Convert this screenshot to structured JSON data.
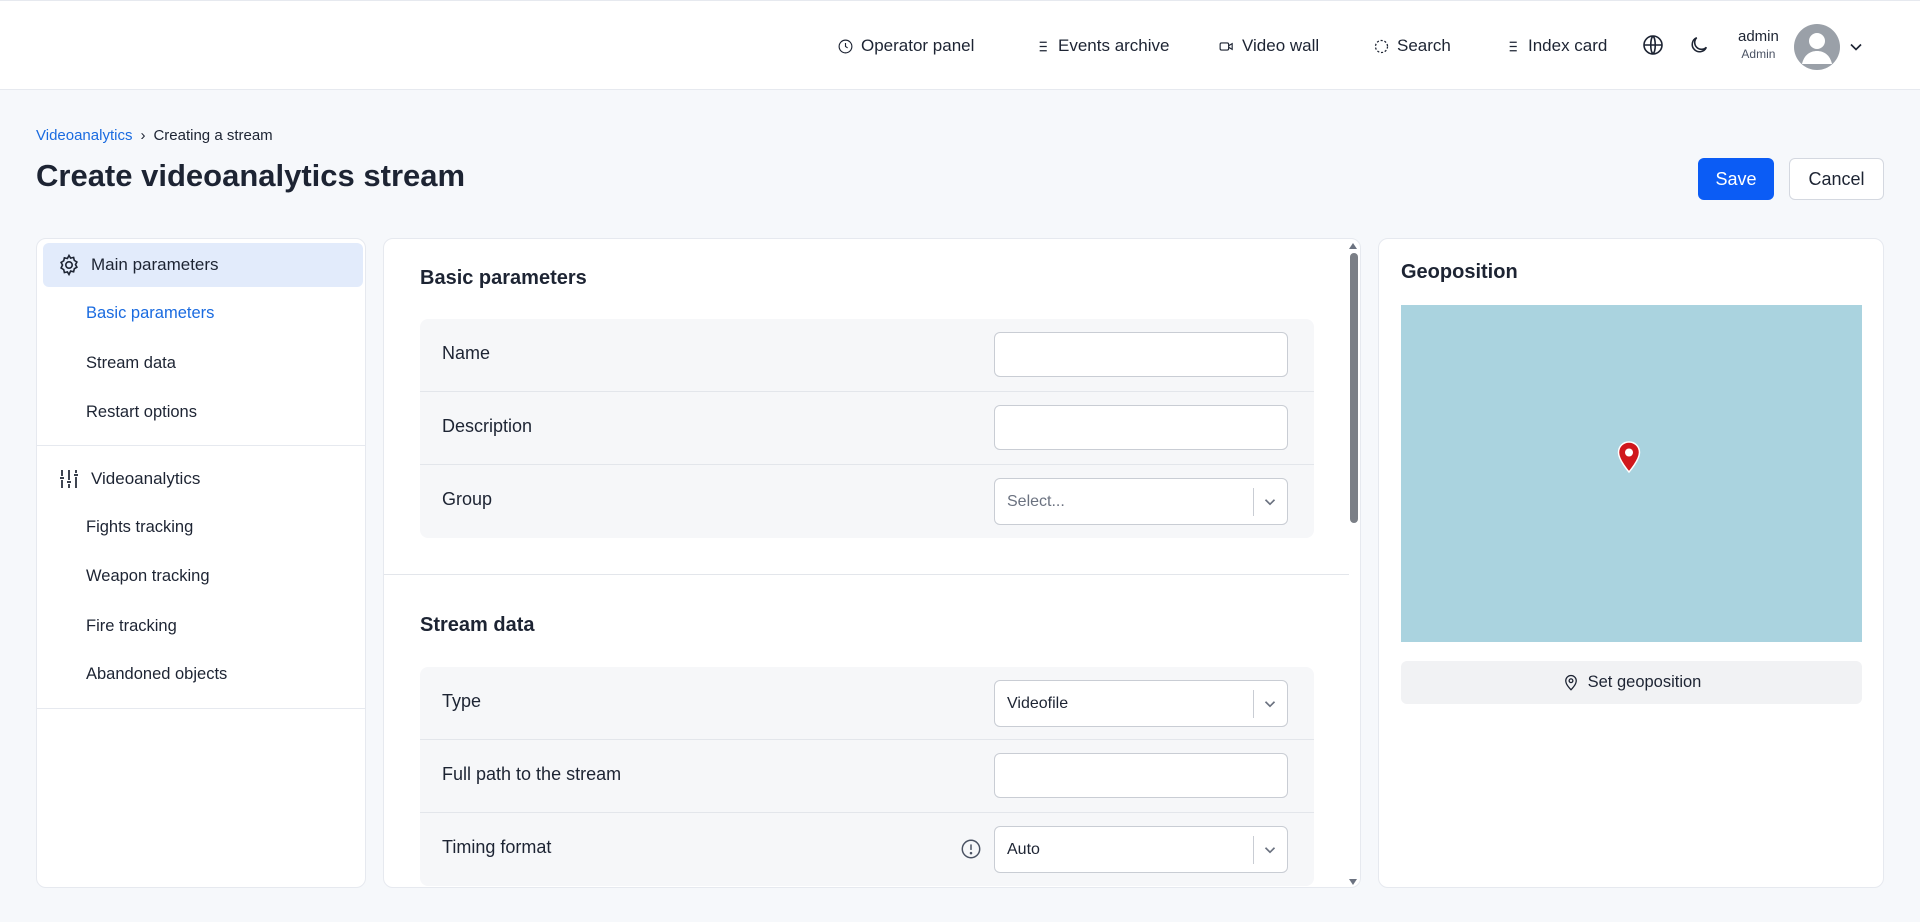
{
  "topnav": {
    "items": [
      {
        "label": "Operator panel",
        "icon": "clock-icon"
      },
      {
        "label": "Events archive",
        "icon": "list-icon"
      },
      {
        "label": "Video wall",
        "icon": "video-camera-icon"
      },
      {
        "label": "Search",
        "icon": "dashed-circle-icon"
      },
      {
        "label": "Index card",
        "icon": "list-icon"
      }
    ],
    "user": {
      "name": "admin",
      "role": "Admin"
    }
  },
  "breadcrumb": {
    "parent": "Videoanalytics",
    "separator": "›",
    "current": "Creating a stream"
  },
  "page": {
    "title": "Create videoanalytics stream",
    "save_label": "Save",
    "cancel_label": "Cancel"
  },
  "sidebar": {
    "groups": [
      {
        "label": "Main parameters",
        "icon": "gear-icon",
        "active": true,
        "items": [
          "Basic parameters",
          "Stream data",
          "Restart options"
        ]
      },
      {
        "label": "Videoanalytics",
        "icon": "sliders-icon",
        "active": false,
        "items": [
          "Fights tracking",
          "Weapon tracking",
          "Fire tracking",
          "Abandoned objects"
        ]
      }
    ]
  },
  "basic": {
    "title": "Basic parameters",
    "name_label": "Name",
    "name_value": "",
    "description_label": "Description",
    "description_value": "",
    "group_label": "Group",
    "group_placeholder": "Select..."
  },
  "stream": {
    "title": "Stream data",
    "type_label": "Type",
    "type_value": "Videofile",
    "path_label": "Full path to the stream",
    "path_value": "",
    "timing_label": "Timing format",
    "timing_value": "Auto"
  },
  "geo": {
    "title": "Geoposition",
    "set_label": "Set geoposition",
    "map_color": "#aad3df",
    "pin_color": "#d0171c"
  },
  "colors": {
    "accent": "#0b5cf5",
    "link": "#1a6be0",
    "active_bg": "#e2ebfb"
  }
}
